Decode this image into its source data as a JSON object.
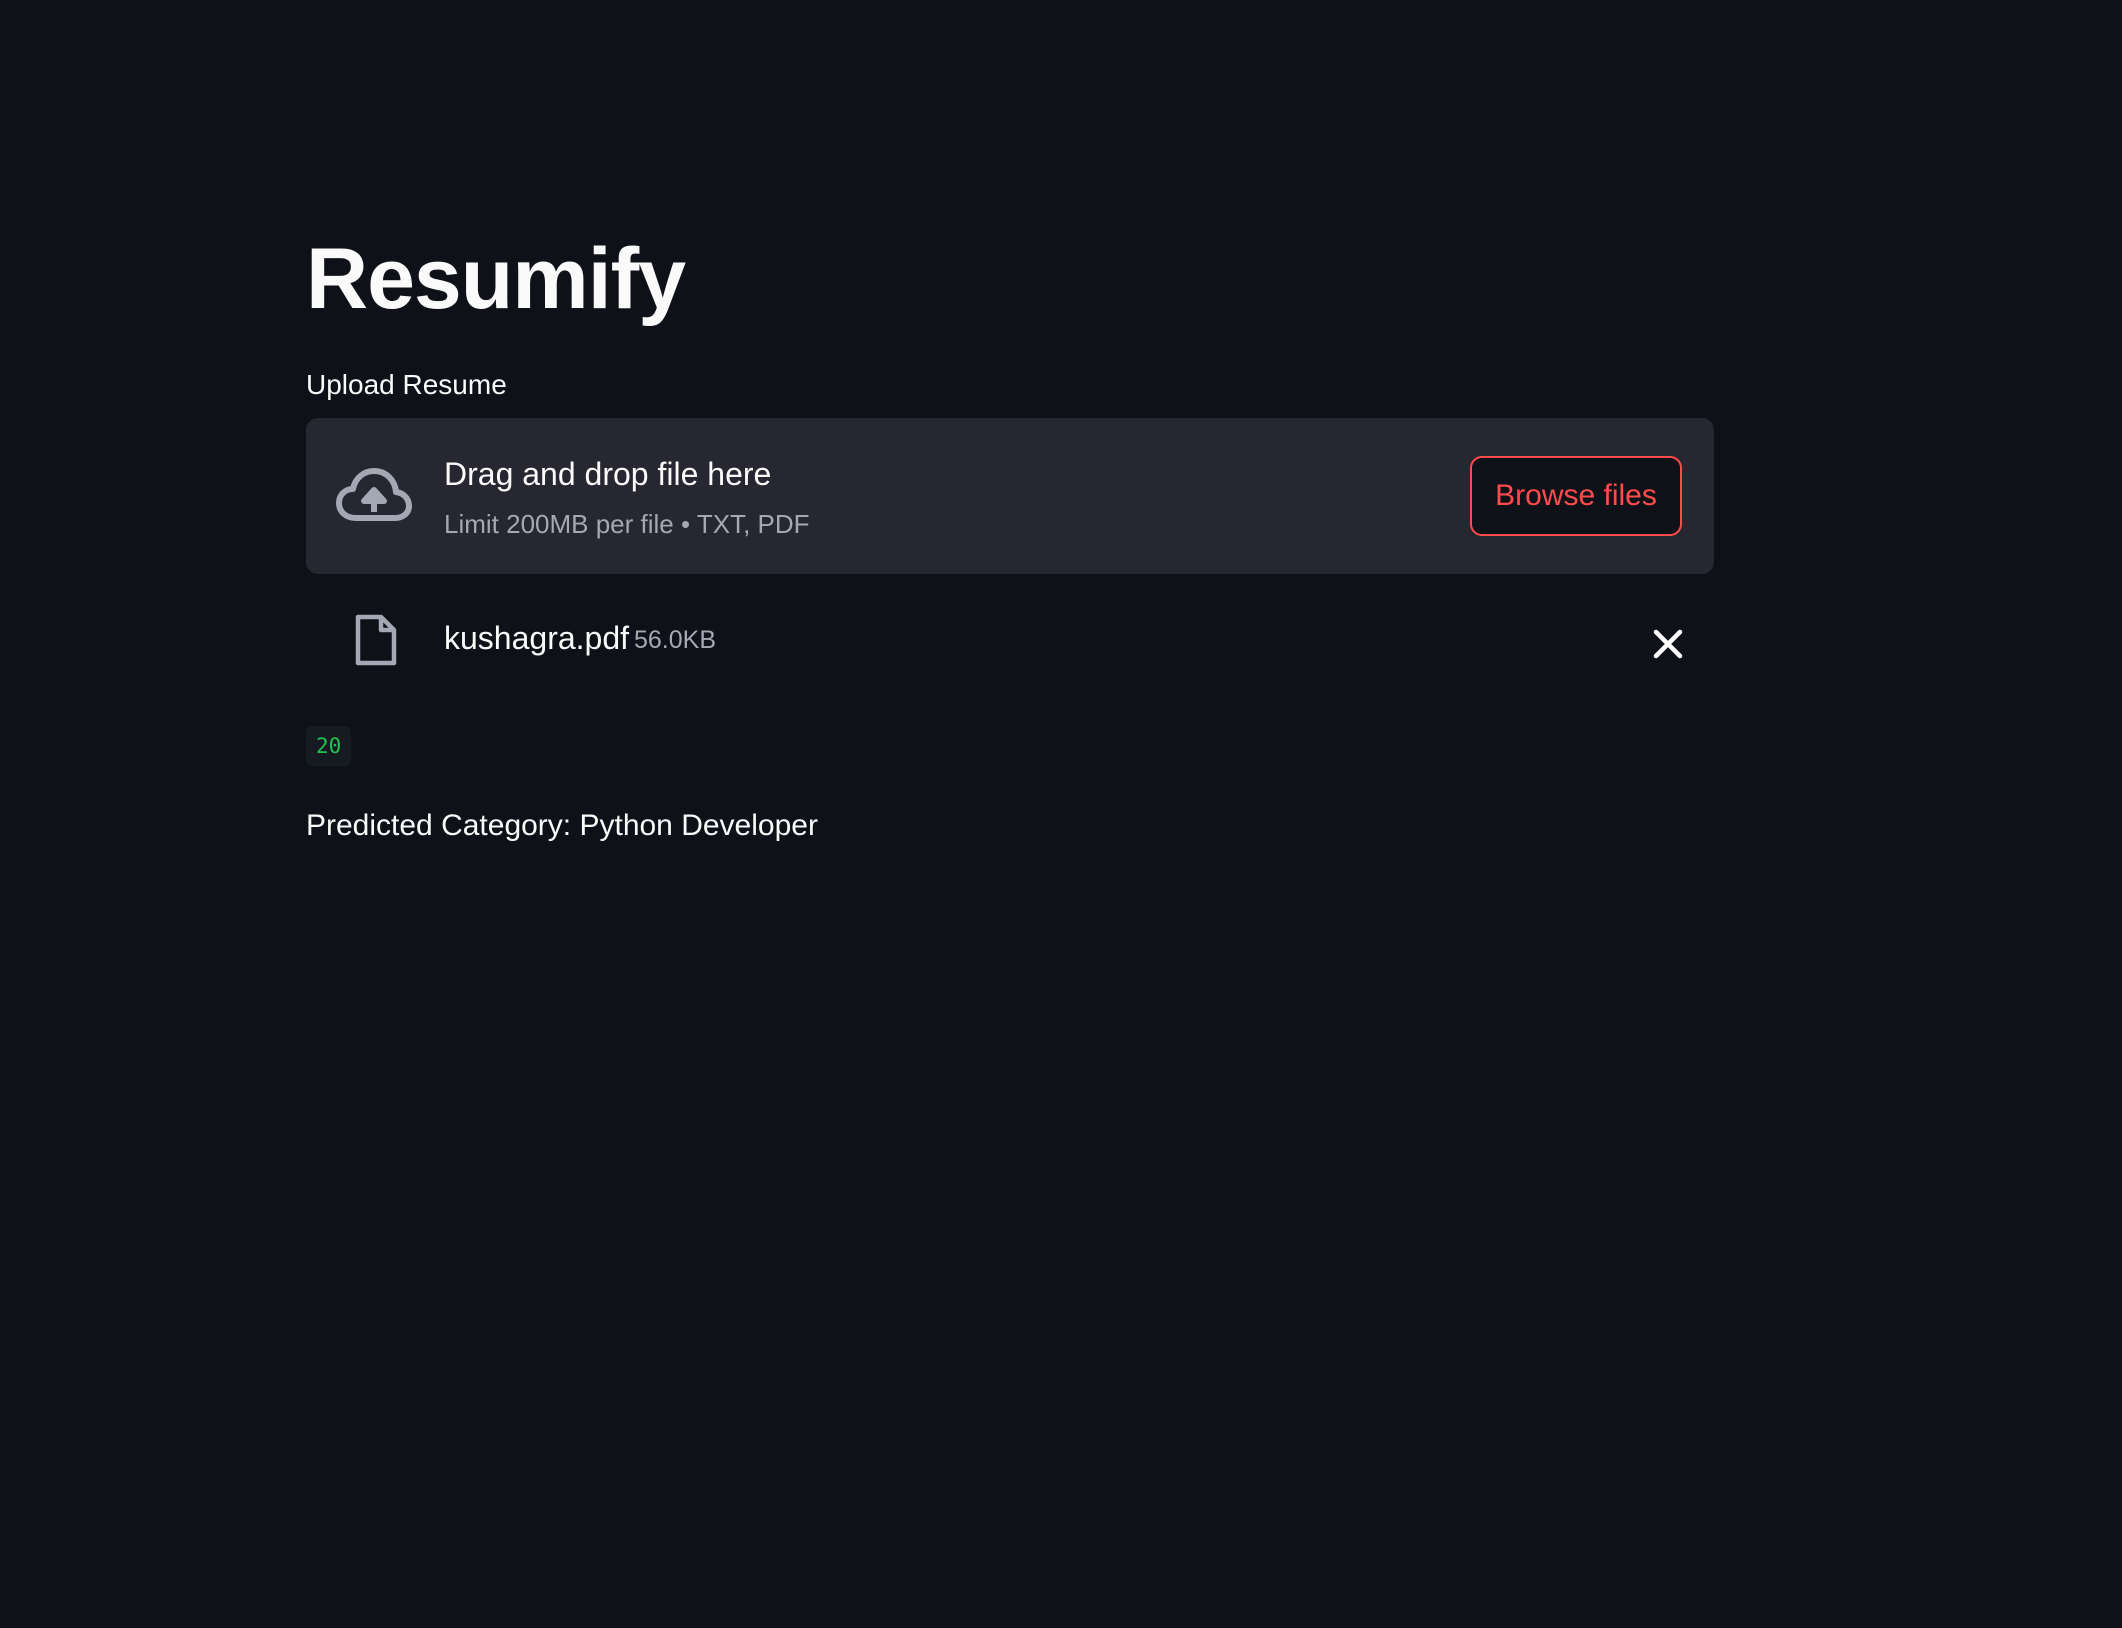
{
  "page": {
    "title": "Resumify"
  },
  "uploader": {
    "label": "Upload Resume",
    "dropzone_title": "Drag and drop file here",
    "dropzone_subtitle": "Limit 200MB per file • TXT, PDF",
    "browse_label": "Browse files",
    "upload_icon": "cloud-upload-icon"
  },
  "uploaded_file": {
    "name": "kushagra.pdf",
    "size": "56.0KB",
    "file_icon": "file-icon",
    "remove_icon": "close-icon"
  },
  "output": {
    "code_value": "20",
    "prediction": "Predicted Category: Python Developer"
  },
  "colors": {
    "background": "#0e1118",
    "dropzone": "#262730",
    "accent": "#ff4b4b",
    "code_text": "#21c354",
    "muted_text": "#a3a8b4"
  }
}
